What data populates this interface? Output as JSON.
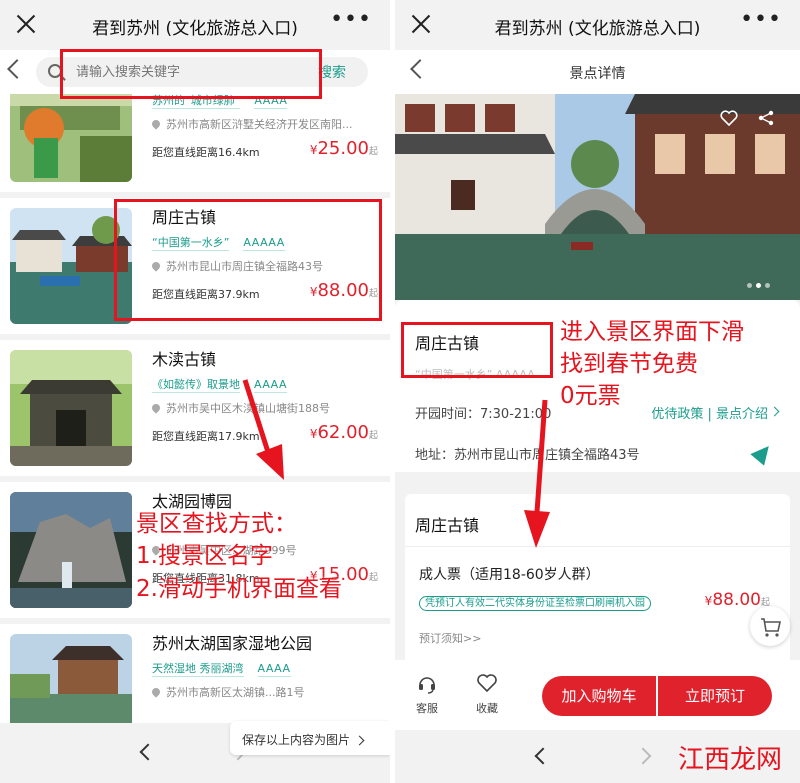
{
  "colors": {
    "accent": "#1b9c8c",
    "price": "#e0222d",
    "annotation": "#e5141e"
  },
  "window": {
    "title": "君到苏州 (文化旅游总入口)",
    "more_label": "•••"
  },
  "search": {
    "placeholder": "请输入搜索关键字",
    "button": "搜索"
  },
  "list": {
    "currency": "¥",
    "price_suffix": "起",
    "items": [
      {
        "name": "",
        "tags": [
          "苏州的“城市绿肺”"
        ],
        "level": "AAAA",
        "address": "苏州市高新区浒墅关经济开发区南阳...",
        "distance": "距您直线距离16.4km",
        "price": "25.00"
      },
      {
        "name": "周庄古镇",
        "tags": [
          "“中国第一水乡”"
        ],
        "level": "AAAAA",
        "address": "苏州市昆山市周庄镇全福路43号",
        "distance": "距您直线距离37.9km",
        "price": "88.00"
      },
      {
        "name": "木渎古镇",
        "tags": [
          "《如懿传》取景地"
        ],
        "level": "AAAA",
        "address": "苏州市吴中区木渎镇山塘街188号",
        "distance": "距您直线距离17.9km",
        "price": "62.00"
      },
      {
        "name": "太湖园博园",
        "tags": [],
        "level": "",
        "address": "苏州市吴中区...湖路999号",
        "distance": "距您直线距离31.8km",
        "price": "15.00"
      },
      {
        "name": "苏州太湖国家湿地公园",
        "tags": [
          "天然湿地 秀丽湖湾"
        ],
        "level": "AAAA",
        "address": "苏州市高新区太湖镇...路1号",
        "distance": "",
        "price": ""
      }
    ]
  },
  "save_tip": "保存以上内容为图片",
  "detail": {
    "header_title": "景点详情",
    "spot_name": "周庄古镇",
    "slogan": "“中国第一水乡”  AAAAA",
    "open_time": "开园时间：7:30-21:00",
    "policy_link": "优待政策 | 景点介绍",
    "address": "地址：苏州市昆山市周庄镇全福路43号",
    "ticket": {
      "spot_name": "周庄古镇",
      "name": "成人票（适用18-60岁人群）",
      "note": "凭预订人有效二代实体身份证至检票口刷闸机入园",
      "currency": "¥",
      "price": "88.00",
      "price_suffix": "起",
      "booking_notice": "预订须知>>"
    },
    "bottom": {
      "service": "客服",
      "favorite": "收藏",
      "add_cart": "加入购物车",
      "book_now": "立即预订"
    }
  },
  "annotations": {
    "left_lines": [
      "景区查找方式：",
      "1.搜景区名字",
      "2.滑动手机界面查看"
    ],
    "right_lines": [
      "进入景区界面下滑",
      "找到春节免费",
      "0元票"
    ]
  },
  "watermark": {
    "text": "江西龙网"
  }
}
